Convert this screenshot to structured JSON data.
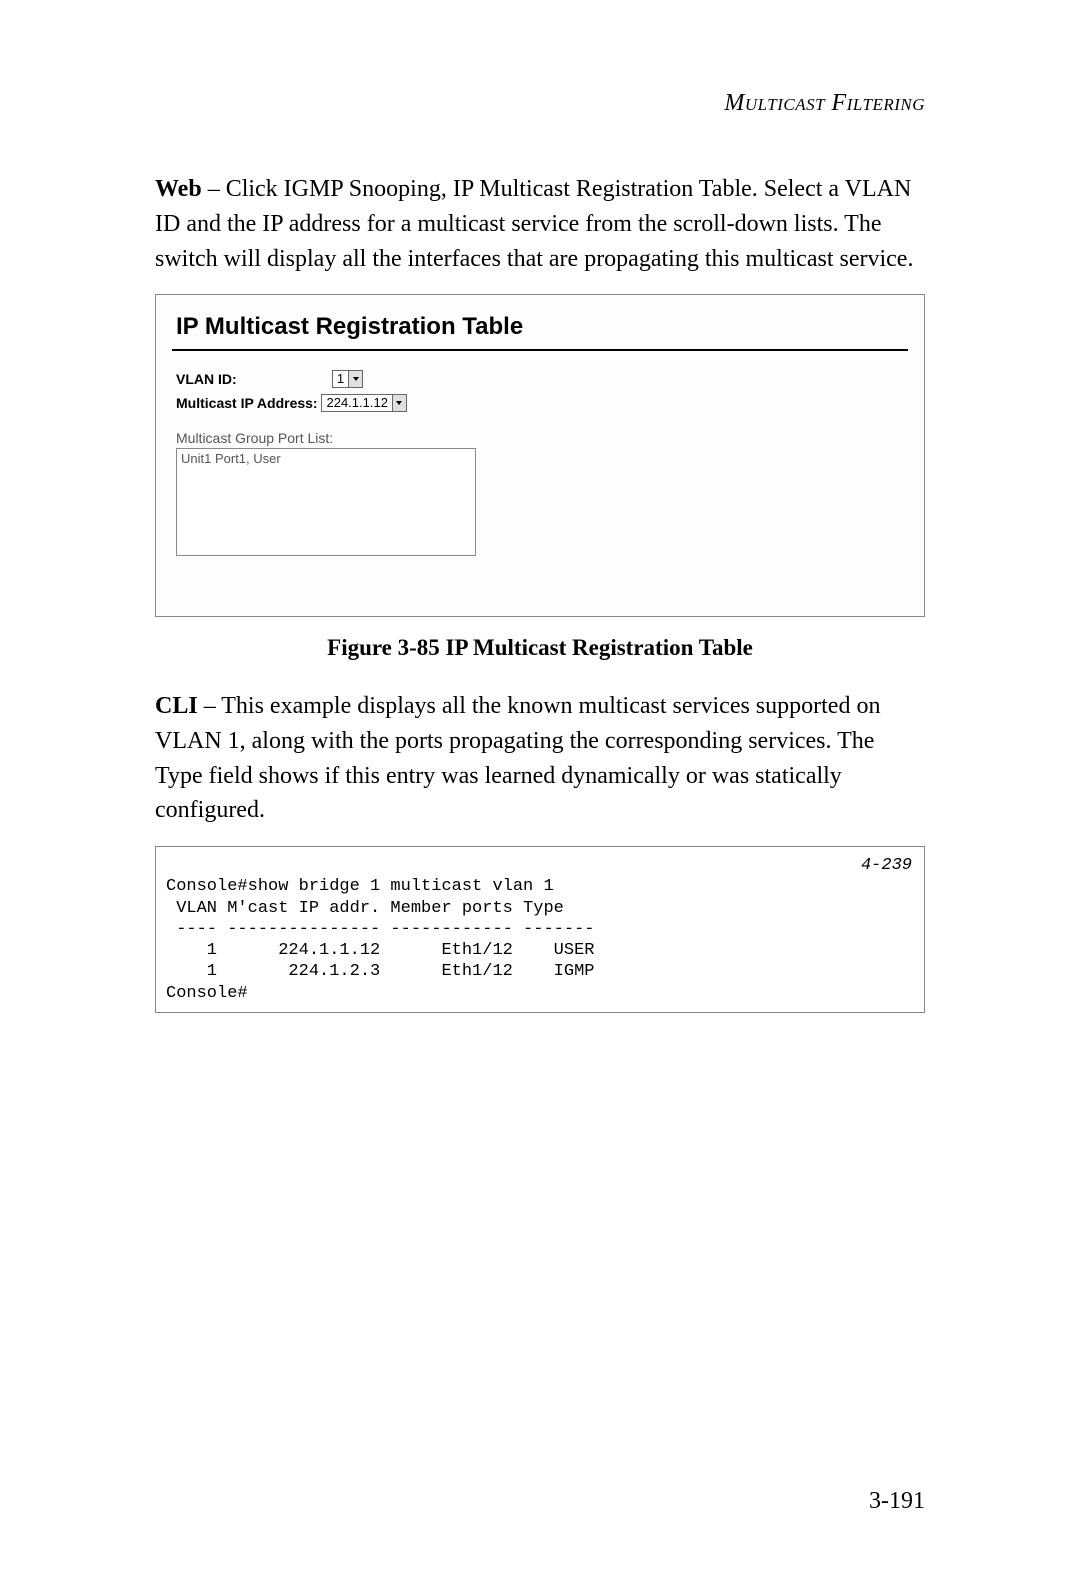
{
  "header": {
    "running": "Multicast Filtering"
  },
  "web_section": {
    "label": "Web",
    "text_after": " – Click IGMP Snooping, IP Multicast Registration Table. Select a VLAN ID and the IP address for a multicast service from the scroll-down lists. The switch will display all the interfaces that are propagating this multicast service."
  },
  "figure": {
    "panel_title": "IP Multicast Registration Table",
    "vlan_label": "VLAN ID:",
    "vlan_value": "1",
    "mcast_label": "Multicast IP Address:",
    "mcast_value": "224.1.1.12",
    "port_list_label": "Multicast Group Port List:",
    "port_list_item": "Unit1 Port1, User",
    "caption": "Figure 3-85  IP Multicast Registration Table"
  },
  "cli_section": {
    "label": "CLI",
    "text_after": " – This example displays all the known multicast services supported on VLAN 1, along with the ports propagating the corresponding services. The Type field shows if this entry was learned dynamically or was statically configured."
  },
  "cli_output": {
    "ref": "4-239",
    "line1": "Console#show bridge 1 multicast vlan 1",
    "line2": " VLAN M'cast IP addr. Member ports Type",
    "line3": " ---- --------------- ------------ -------",
    "line4": "    1      224.1.1.12      Eth1/12    USER",
    "line5": "    1       224.1.2.3      Eth1/12    IGMP",
    "line6": "Console#"
  },
  "page_number": "3-191"
}
